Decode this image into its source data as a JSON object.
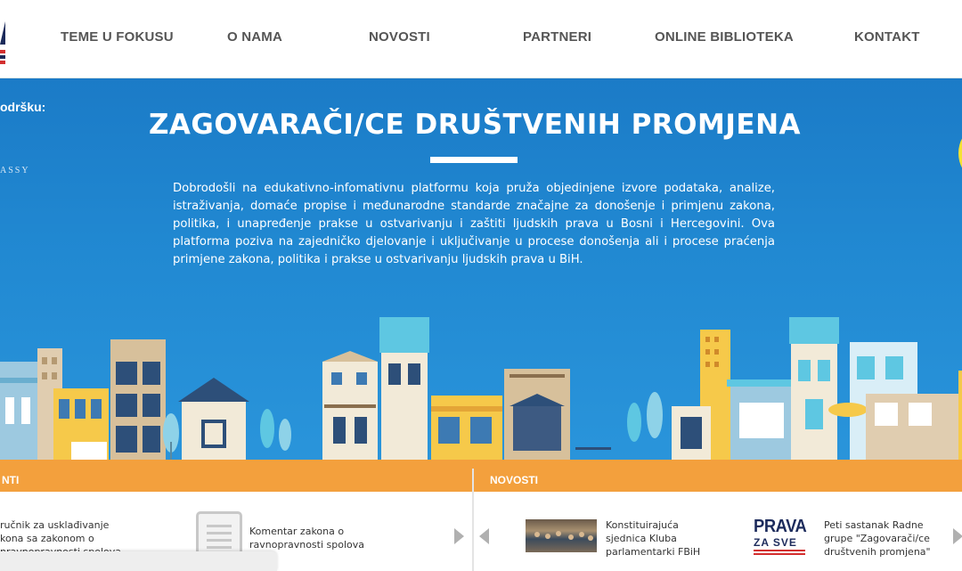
{
  "header": {
    "nav": [
      {
        "label": "TEME U FOKUSU"
      },
      {
        "label": "O NAMA"
      },
      {
        "label": "NOVOSTI"
      },
      {
        "label": "PARTNERI"
      },
      {
        "label": "ONLINE BIBLIOTEKA"
      },
      {
        "label": "KONTAKT"
      }
    ]
  },
  "hero": {
    "support_label": "odršku:",
    "embassy_label": "ASSY",
    "title": "ZAGOVARAČI/CE DRUŠTVENIH PROMJENA",
    "intro": "Dobrodošli na edukativno-infomativnu platformu koja pruža objedinjene izvore podataka, analize, istraživanja, domaće propise i međunarodne standarde značajne za donošenje i primjenu zakona, politika, i unapređenje prakse u ostvarivanju i zaštiti ljudskih prava u Bosni i Hercegovini. Ova platforma poziva na zajedničko djelovanje i uključivanje u procese donošenja ali i procese praćenja primjene zakona, politika i prakse u ostvarivanju ljudskih prava u BiH."
  },
  "left_panel": {
    "title": "NTI",
    "item1_text": "ručnik za usklađivanje\nkona sa zakonom o\nnravnopravnosti spolova\nn...",
    "item2_text": "Komentar zakona o\nravnopravnosti spolova"
  },
  "right_panel": {
    "title": "NOVOSTI",
    "item1_text": "Konstituirajuća\nsjednica Kluba\nparlamentarki FBiH",
    "item2_logo_top": "PRAVA",
    "item2_logo_bottom": "ZA SVE",
    "item2_text": "Peti sastanak Radne\ngrupe \"Zagovarači/ce\ndruštvenih promjena\""
  },
  "colors": {
    "hero_blue": "#2189d2",
    "orange_bar": "#f3a03d",
    "nav_text": "#555555"
  }
}
